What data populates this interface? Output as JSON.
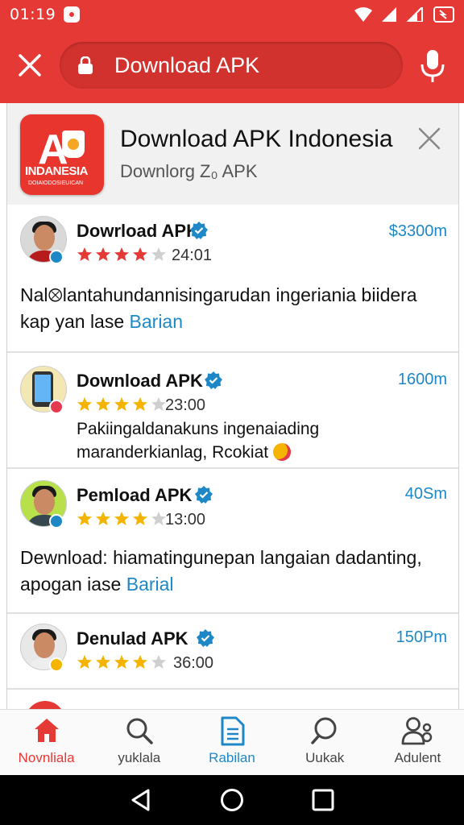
{
  "status_bar": {
    "time": "01:19"
  },
  "search": {
    "query": "Download APK"
  },
  "app": {
    "title": "Download APK Indonesia",
    "subtitle": "Downlorg Z₀ APK",
    "logo_text": "INDANESIA",
    "logo_subtext": "DOIAIODOSIEUICAN",
    "logo_letter": "A"
  },
  "reviews": [
    {
      "name": "Dowrload APK",
      "time": "24:01",
      "size": "$3300m",
      "rating": 4,
      "star_color": "#e53935",
      "text": "Nal⮾lantahundannisingarudan ingeriania biidera kap yan lase ",
      "link": "Barian"
    },
    {
      "name": "Download APK",
      "time": "23:00",
      "size": "1600m",
      "rating": 4,
      "star_color": "#f5b400",
      "text": "Pakiingaldanakuns ingenaiading maranderkianlag, Rcokiat ",
      "link": ""
    },
    {
      "name": "Pemload APK",
      "time": "13:00",
      "size": "40Sm",
      "rating": 4,
      "star_color": "#f5b400",
      "text": "Dewnload: hiamatingunepan langaian dadanting, apogan iase ",
      "link": "Barial"
    },
    {
      "name": "Denulad APK",
      "time": "36:00",
      "size": "150Pm",
      "rating": 4,
      "star_color": "#f5b400",
      "text": "",
      "link": ""
    }
  ],
  "bottom_nav": [
    {
      "label": "Novnliala",
      "icon": "home-icon"
    },
    {
      "label": "yuklala",
      "icon": "search-icon"
    },
    {
      "label": "Rabilan",
      "icon": "document-icon"
    },
    {
      "label": "Uukak",
      "icon": "search-icon"
    },
    {
      "label": "Adulent",
      "icon": "user-icon"
    }
  ],
  "colors": {
    "brand_red": "#e53935",
    "link_blue": "#1e88c7",
    "star_gold": "#f5b400"
  }
}
